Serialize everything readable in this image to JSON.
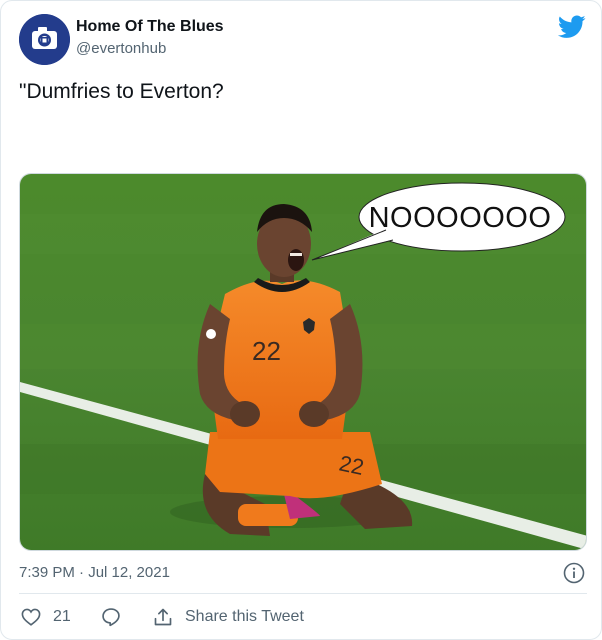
{
  "author": {
    "display_name": "Home Of The Blues",
    "handle": "@evertonhub",
    "avatar_icon": "camera-logo-icon",
    "avatar_color": "#233c8c"
  },
  "tweet": {
    "text": "\"Dumfries to Everton?",
    "media": {
      "speech_bubble_text": "NOOOOOOO",
      "jersey_number": "22"
    },
    "timestamp": "7:39 PM · Jul 12, 2021"
  },
  "actions": {
    "like_count": "21",
    "share_label": "Share this Tweet"
  },
  "colors": {
    "twitter_blue": "#1d9bf0",
    "secondary_text": "#536471",
    "pitch_green": "#4f8a2e",
    "jersey_orange": "#f07a1c"
  }
}
